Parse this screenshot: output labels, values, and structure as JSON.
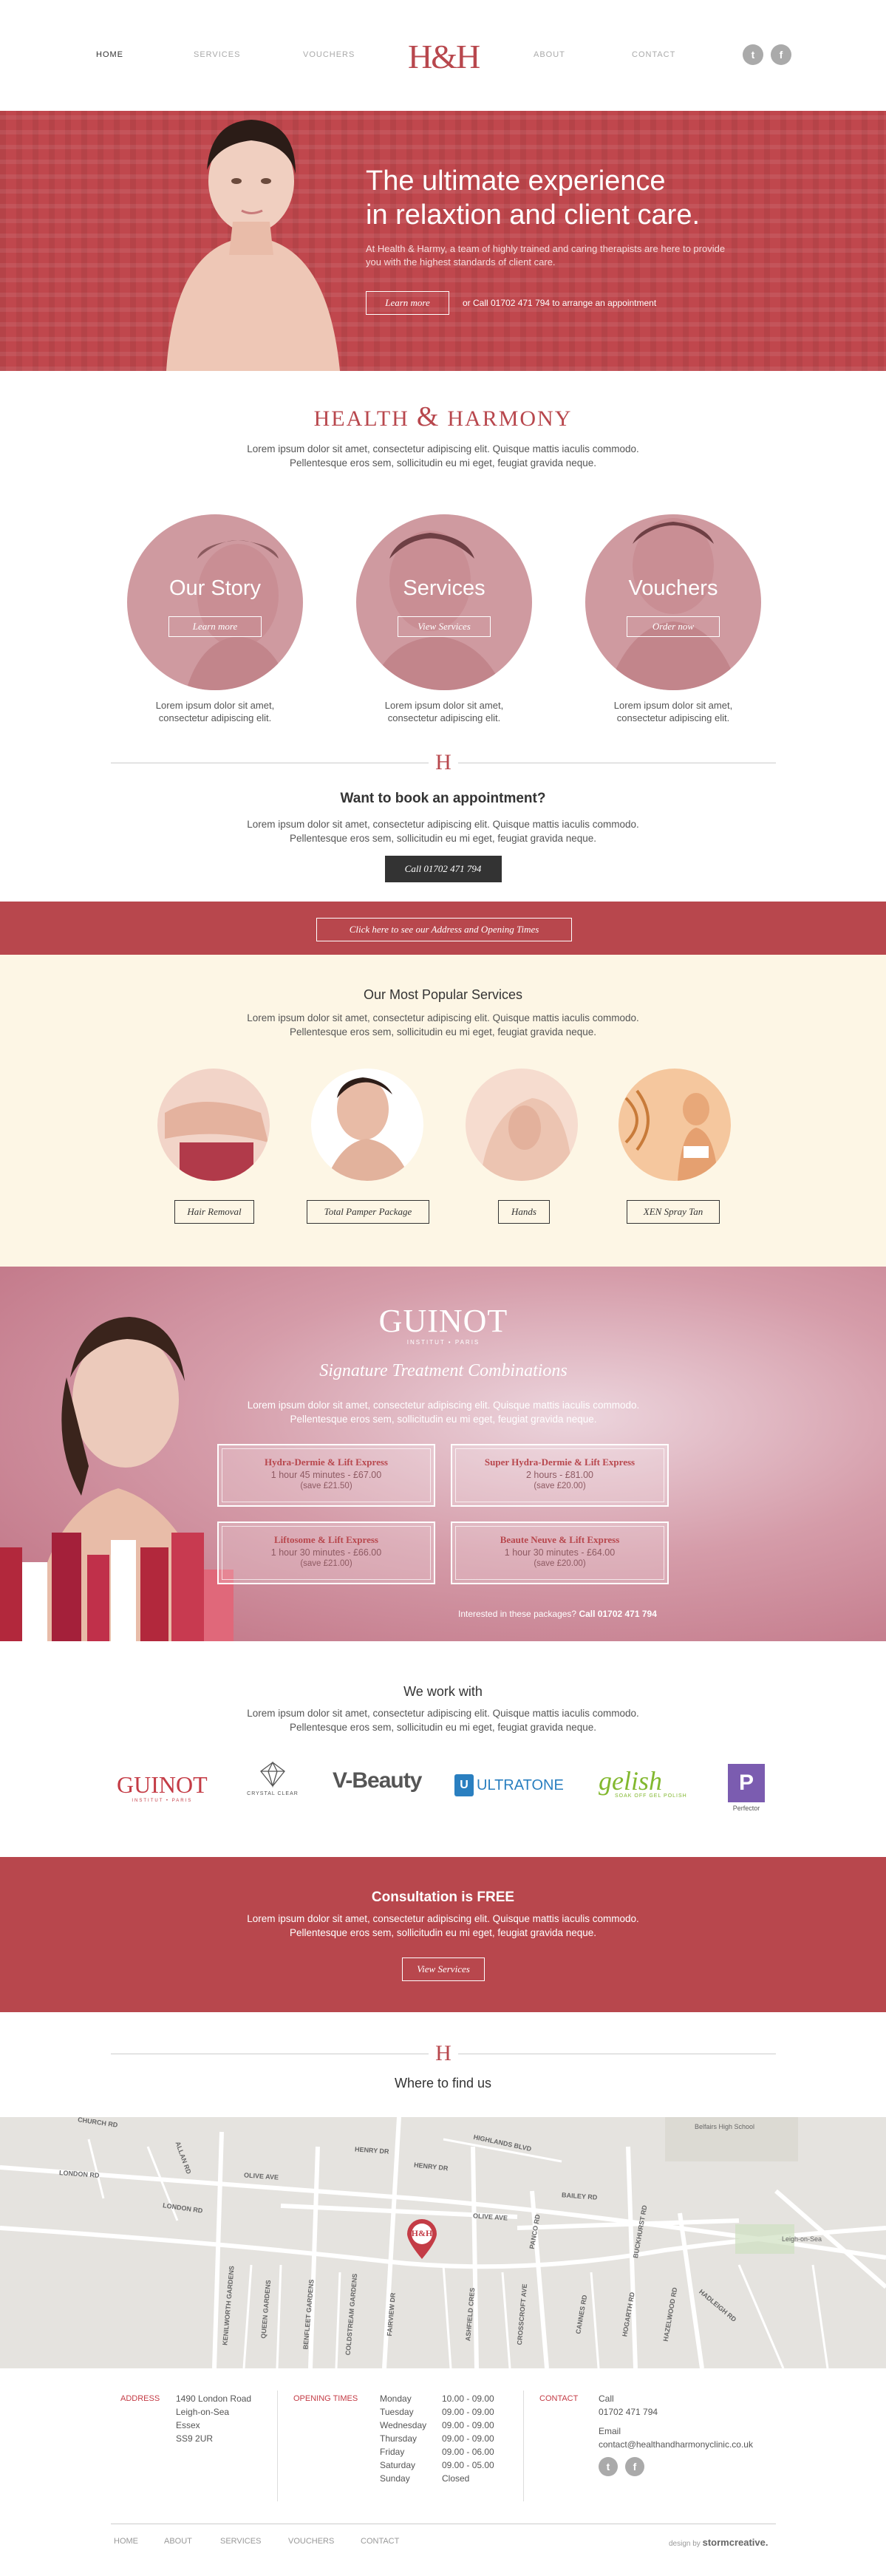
{
  "nav": {
    "home": "HOME",
    "services": "SERVICES",
    "vouchers": "VOUCHERS",
    "about": "ABOUT",
    "contact": "CONTACT",
    "logo": "H&H",
    "twitter_glyph": "t",
    "facebook_glyph": "f"
  },
  "hero": {
    "title_line1": "The ultimate experience",
    "title_line2": "in relaxtion and client care.",
    "subtitle": "At Health & Harmy, a team of highly trained and caring therapists are here to provide you with the highest standards of client care.",
    "button": "Learn more",
    "call": "or Call 01702 471 794 to arrange an appointment"
  },
  "intro": {
    "title_left": "HEALTH",
    "title_amp": "&",
    "title_right": "HARMONY",
    "lorem_line1": "Lorem ipsum dolor sit amet, consectetur adipiscing elit. Quisque mattis iaculis commodo.",
    "lorem_line2": "Pellentesque eros sem, sollicitudin eu mi eget, feugiat gravida neque."
  },
  "features": [
    {
      "label": "Our Story",
      "button": "Learn more",
      "text_line1": "Lorem ipsum dolor sit amet,",
      "text_line2": "consectetur adipiscing elit."
    },
    {
      "label": "Services",
      "button": "View Services",
      "text_line1": "Lorem ipsum dolor sit amet,",
      "text_line2": "consectetur adipiscing elit."
    },
    {
      "label": "Vouchers",
      "button": "Order now",
      "text_line1": "Lorem ipsum dolor sit amet,",
      "text_line2": "consectetur adipiscing elit."
    }
  ],
  "divider_mark": "H",
  "book": {
    "title": "Want to book an appointment?",
    "lorem_line1": "Lorem ipsum dolor sit amet, consectetur adipiscing elit. Quisque mattis iaculis commodo.",
    "lorem_line2": "Pellentesque eros sem, sollicitudin eu mi eget, feugiat gravida neque.",
    "button": "Call 01702 471 794"
  },
  "address_bar": {
    "button": "Click here to see our Address and Opening Times"
  },
  "popular": {
    "title": "Our Most Popular Services",
    "lorem_line1": "Lorem ipsum dolor sit amet, consectetur adipiscing elit. Quisque mattis iaculis commodo.",
    "lorem_line2": "Pellentesque eros sem, sollicitudin eu mi eget, feugiat gravida neque.",
    "items": [
      "Hair Removal",
      "Total Pamper Package",
      "Hands",
      "XEN Spray Tan"
    ]
  },
  "guinot": {
    "logo": "GUINOT",
    "logo_sub": "INSTITUT • PARIS",
    "signature": "Signature Treatment Combinations",
    "lorem_line1": "Lorem ipsum dolor sit amet, consectetur adipiscing elit. Quisque mattis iaculis commodo.",
    "lorem_line2": "Pellentesque eros sem, sollicitudin eu mi eget, feugiat gravida neque.",
    "packages": [
      {
        "name": "Hydra-Dermie & Lift Express",
        "duration": "1 hour 45 minutes - £67.00",
        "save": "(save £21.50)"
      },
      {
        "name": "Super Hydra-Dermie & Lift Express",
        "duration": "2 hours - £81.00",
        "save": "(save £20.00)"
      },
      {
        "name": "Liftosome & Lift Express",
        "duration": "1 hour 30 minutes - £66.00",
        "save": "(save £21.00)"
      },
      {
        "name": "Beaute Neuve & Lift Express",
        "duration": "1 hour 30 minutes - £64.00",
        "save": "(save £20.00)"
      }
    ],
    "interest": "Interested in these packages?",
    "interest_phone": "Call 01702 471 794"
  },
  "partners": {
    "title": "We work with",
    "lorem_line1": "Lorem ipsum dolor sit amet, consectetur adipiscing elit. Quisque mattis iaculis commodo.",
    "lorem_line2": "Pellentesque eros sem, sollicitudin eu mi eget, feugiat gravida neque.",
    "logos": {
      "guinot": "GUINOT",
      "guinot_sub": "INSTITUT • PARIS",
      "crystal": "CRYSTAL CLEAR",
      "vbeauty": "V-Beauty",
      "ultratone": "ULTRATONE",
      "gelish": "gelish",
      "gelish_sub": "SOAK OFF GEL POLISH",
      "perfector": "Perfector"
    }
  },
  "consultation": {
    "title": "Consultation is FREE",
    "lorem_line1": "Lorem ipsum dolor sit amet, consectetur adipiscing elit. Quisque mattis iaculis commodo.",
    "lorem_line2": "Pellentesque eros sem, sollicitudin eu mi eget, feugiat gravida neque.",
    "button": "View Services"
  },
  "find_us": {
    "title": "Where to find us",
    "pin": "H&H",
    "roads": [
      "CHURCH RD",
      "LONDON RD",
      "LONDON RD",
      "ALLAN RD",
      "OLIVE AVE",
      "HENRY DR",
      "HENRY DR",
      "HIGHLANDS BLVD",
      "BAILEY RD",
      "OLIVE AVE",
      "KENILWORTH GARDENS",
      "QUEEN GARDENS",
      "BENFLEET GARDENS",
      "COLDSTREAM GARDENS",
      "FAIRVIEW DR",
      "ASHFIELD CRES",
      "CROSSCROFT AVE",
      "PANCO RD",
      "BUCKHURST RD",
      "CANNES RD",
      "HOGARTH RD",
      "HAZELWOOD RD",
      "HADLEIGH RD",
      "Belfairs High School",
      "Leigh-on-Sea"
    ]
  },
  "footer": {
    "address_label": "ADDRESS",
    "address_lines": [
      "1490 London Road",
      "Leigh-on-Sea",
      "Essex",
      "SS9 2UR"
    ],
    "hours_label": "OPENING TIMES",
    "hours": [
      {
        "day": "Monday",
        "time": "10.00 - 09.00"
      },
      {
        "day": "Tuesday",
        "time": "09.00 - 09.00"
      },
      {
        "day": "Wednesday",
        "time": "09.00 - 09.00"
      },
      {
        "day": "Thursday",
        "time": "09.00 - 09.00"
      },
      {
        "day": "Friday",
        "time": "09.00 - 06.00"
      },
      {
        "day": "Saturday",
        "time": "09.00 - 05.00"
      },
      {
        "day": "Sunday",
        "time": "Closed"
      }
    ],
    "contact_label": "CONTACT",
    "call_label": "Call",
    "phone": "01702 471 794",
    "email_label": "Email",
    "email": "contact@healthandharmonyclinic.co.uk",
    "nav": [
      "HOME",
      "ABOUT",
      "SERVICES",
      "VOUCHERS",
      "CONTACT"
    ],
    "credit_prefix": "design by",
    "credit_name": "stormcreative."
  },
  "colors": {
    "accent": "#b8474d",
    "cream": "#fdf6e5",
    "dark": "#333333"
  }
}
